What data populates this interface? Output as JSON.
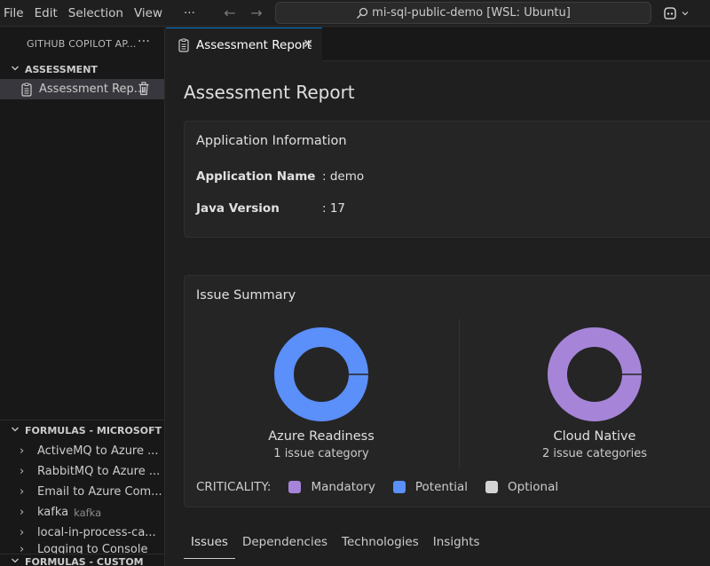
{
  "menu": {
    "items": [
      "File",
      "Edit",
      "Selection",
      "View"
    ],
    "more": "···"
  },
  "command_center": {
    "text": "mi-sql-public-demo [WSL: Ubuntu]"
  },
  "sidebar": {
    "header": "GITHUB COPILOT AP...",
    "more": "···",
    "assessment": {
      "title": "ASSESSMENT",
      "items": [
        {
          "label": "Assessment Rep..."
        }
      ]
    },
    "formulas_microsoft": {
      "title": "FORMULAS - MICROSOFT",
      "items": [
        {
          "label": "ActiveMQ to Azure ...",
          "desc": ""
        },
        {
          "label": "RabbitMQ to Azure ...",
          "desc": ""
        },
        {
          "label": "Email to Azure Com...",
          "desc": ""
        },
        {
          "label": "kafka",
          "desc": "kafka"
        },
        {
          "label": "local-in-process-ca...",
          "desc": ""
        },
        {
          "label": "Logging to Console",
          "desc": ""
        }
      ]
    },
    "formulas_custom": {
      "title": "FORMULAS - CUSTOM"
    }
  },
  "tab": {
    "label": "Assessment Report",
    "close": "✕"
  },
  "report": {
    "title": "Assessment Report",
    "app_info": {
      "title": "Application Information",
      "rows": [
        {
          "label": "Application Name",
          "value": ": demo"
        },
        {
          "label": "Java Version",
          "value": ": 17"
        }
      ]
    },
    "issue_summary": {
      "title": "Issue Summary",
      "charts": [
        {
          "title": "Azure Readiness",
          "subtitle": "1 issue category",
          "color": "#5b8ff9"
        },
        {
          "title": "Cloud Native",
          "subtitle": "2 issue categories",
          "color": "#a685d8"
        }
      ],
      "criticality_label": "CRITICALITY:",
      "legend": [
        {
          "label": "Mandatory",
          "color": "#a685d8"
        },
        {
          "label": "Potential",
          "color": "#5b8ff9"
        },
        {
          "label": "Optional",
          "color": "#d4d4d4"
        }
      ]
    },
    "bottom_tabs": [
      "Issues",
      "Dependencies",
      "Technologies",
      "Insights"
    ],
    "active_bottom_tab": "Issues"
  },
  "colors": {
    "accent": "#0078d4",
    "mandatory": "#a685d8",
    "potential": "#5b8ff9",
    "optional": "#d4d4d4"
  }
}
